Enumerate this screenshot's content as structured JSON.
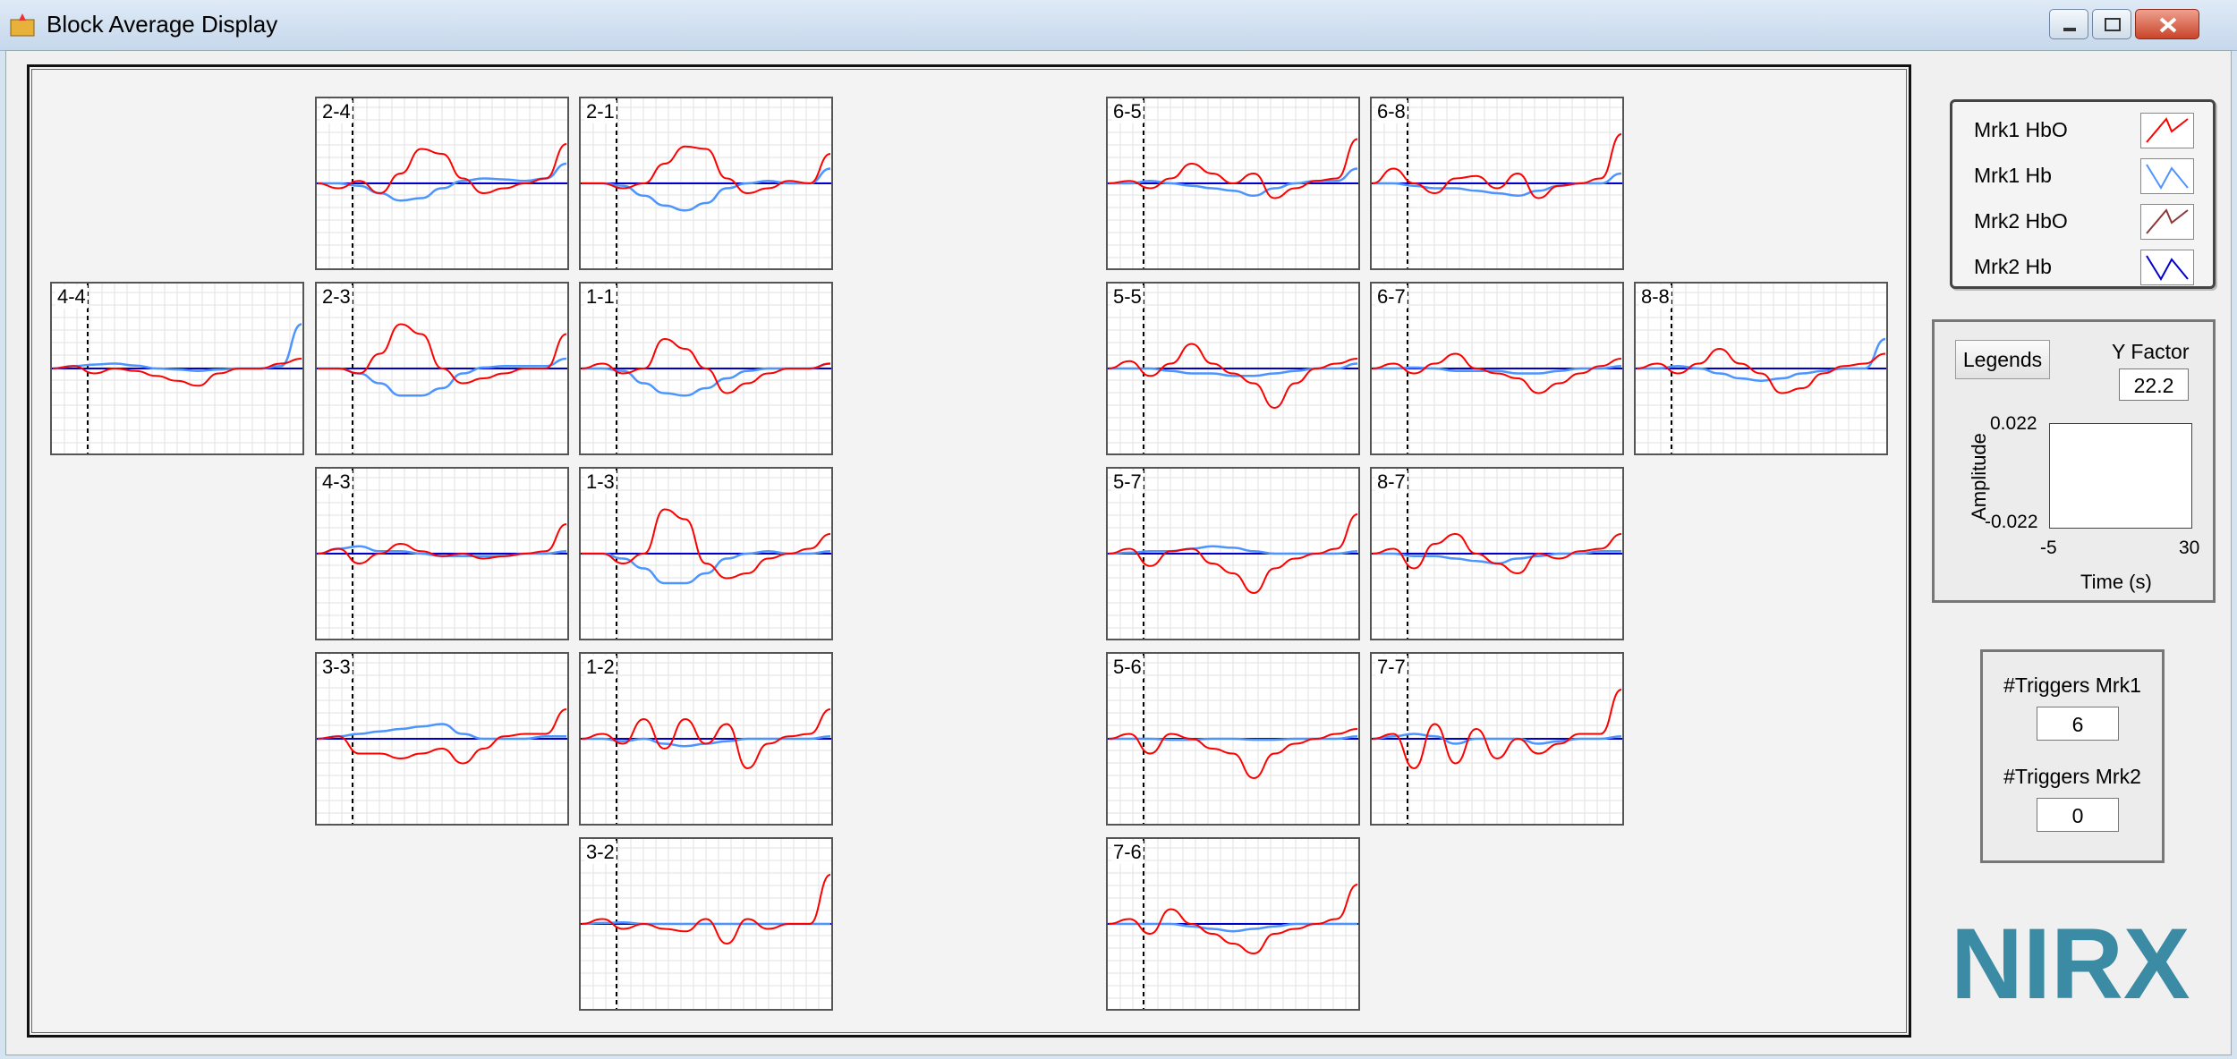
{
  "window": {
    "title": "Block Average Display",
    "icon": "nirx-app-icon"
  },
  "colors": {
    "mrk1_hbo": "#ff0000",
    "mrk1_hb": "#4d94ff",
    "mrk2_hbo": "#8b3a3a",
    "mrk2_hb": "#0000cc",
    "logo_teal": "#3b8ba4",
    "logo_orange": "#f0a020"
  },
  "plots": [
    {
      "label": "2-4",
      "hbo": [
        0,
        -0.1,
        0.05,
        -0.2,
        0.2,
        0.7,
        0.6,
        0.1,
        -0.2,
        -0.1,
        0,
        0.1,
        0.8
      ],
      "hb": [
        0,
        0,
        -0.05,
        -0.2,
        -0.35,
        -0.3,
        -0.1,
        0.05,
        0.1,
        0.08,
        0.05,
        0.1,
        0.4
      ]
    },
    {
      "label": "2-1",
      "hbo": [
        0,
        0,
        -0.1,
        0,
        0.4,
        0.75,
        0.7,
        0.1,
        -0.2,
        -0.1,
        0.05,
        0,
        0.6
      ],
      "hb": [
        0,
        0,
        -0.05,
        -0.25,
        -0.45,
        -0.55,
        -0.4,
        -0.1,
        0,
        0.05,
        0,
        0,
        0.3
      ]
    },
    {
      "label": "6-5",
      "hbo": [
        0,
        0.05,
        -0.1,
        0.1,
        0.4,
        0.2,
        0,
        0.2,
        -0.3,
        -0.1,
        0.05,
        0.1,
        0.9
      ],
      "hb": [
        0,
        0,
        0.05,
        0,
        -0.05,
        -0.1,
        -0.15,
        -0.25,
        -0.1,
        0,
        0.05,
        0.05,
        0.3
      ]
    },
    {
      "label": "6-8",
      "hbo": [
        0,
        0.3,
        0,
        -0.2,
        0.1,
        0.15,
        -0.1,
        0.2,
        -0.3,
        -0.05,
        0,
        0.1,
        1.0
      ],
      "hb": [
        0,
        0,
        -0.05,
        -0.1,
        -0.1,
        -0.15,
        -0.2,
        -0.25,
        -0.15,
        -0.05,
        0,
        0,
        0.2
      ]
    },
    {
      "label": "4-4",
      "hbo": [
        0,
        0.05,
        -0.1,
        0,
        -0.05,
        -0.15,
        -0.25,
        -0.35,
        -0.1,
        0,
        0,
        0.1,
        0.2
      ],
      "hb": [
        0,
        0.05,
        0.08,
        0.1,
        0.06,
        0,
        -0.02,
        -0.05,
        -0.02,
        0,
        0,
        0.05,
        0.9
      ]
    },
    {
      "label": "2-3",
      "hbo": [
        0,
        0,
        -0.1,
        0.3,
        0.9,
        0.7,
        0,
        -0.3,
        -0.2,
        -0.1,
        0,
        0,
        0.7
      ],
      "hb": [
        0,
        0,
        -0.1,
        -0.3,
        -0.55,
        -0.55,
        -0.4,
        -0.1,
        0.02,
        0.05,
        0.05,
        0.05,
        0.2
      ]
    },
    {
      "label": "1-1",
      "hbo": [
        0,
        0.1,
        -0.1,
        0,
        0.6,
        0.4,
        0,
        -0.5,
        -0.3,
        -0.1,
        0,
        0,
        0.1
      ],
      "hb": [
        0,
        0,
        -0.05,
        -0.3,
        -0.5,
        -0.55,
        -0.4,
        -0.2,
        -0.05,
        0,
        0,
        0,
        0.1
      ]
    },
    {
      "label": "5-5",
      "hbo": [
        0,
        0.15,
        -0.15,
        0.1,
        0.5,
        0.1,
        -0.1,
        -0.3,
        -0.8,
        -0.3,
        0,
        0.1,
        0.2
      ],
      "hb": [
        0,
        0,
        0,
        -0.05,
        -0.1,
        -0.1,
        -0.15,
        -0.15,
        -0.1,
        -0.05,
        0,
        0,
        0.1
      ]
    },
    {
      "label": "6-7",
      "hbo": [
        0,
        0.1,
        -0.1,
        0.1,
        0.3,
        0,
        -0.1,
        -0.2,
        -0.5,
        -0.3,
        -0.1,
        0.05,
        0.2
      ],
      "hb": [
        0,
        0,
        0.02,
        0,
        -0.05,
        -0.05,
        -0.05,
        -0.1,
        -0.1,
        -0.05,
        0,
        0,
        0.05
      ]
    },
    {
      "label": "8-8",
      "hbo": [
        0,
        0.1,
        -0.1,
        0.1,
        0.4,
        0.1,
        -0.1,
        -0.5,
        -0.4,
        -0.1,
        0.05,
        0.1,
        0.3
      ],
      "hb": [
        0,
        0,
        0.05,
        0,
        -0.1,
        -0.2,
        -0.25,
        -0.2,
        -0.1,
        -0.05,
        0,
        0,
        0.6
      ]
    },
    {
      "label": "4-3",
      "hbo": [
        0,
        0.1,
        -0.2,
        0,
        0.2,
        0.05,
        -0.05,
        0,
        -0.1,
        -0.05,
        0,
        0.05,
        0.6
      ],
      "hb": [
        0,
        0.1,
        0.15,
        0.05,
        0.05,
        0,
        -0.05,
        -0.05,
        -0.05,
        -0.05,
        0,
        0,
        0.05
      ]
    },
    {
      "label": "1-3",
      "hbo": [
        0,
        0,
        -0.2,
        0,
        0.9,
        0.7,
        -0.2,
        -0.5,
        -0.4,
        -0.1,
        0,
        0.1,
        0.4
      ],
      "hb": [
        0,
        0,
        -0.1,
        -0.3,
        -0.6,
        -0.6,
        -0.4,
        -0.1,
        0,
        0.05,
        0,
        0,
        0.05
      ]
    },
    {
      "label": "5-7",
      "hbo": [
        0,
        0.1,
        -0.25,
        0.05,
        0.1,
        -0.2,
        -0.4,
        -0.8,
        -0.3,
        -0.1,
        0,
        0.1,
        0.8
      ],
      "hb": [
        0,
        0.02,
        0.05,
        0.05,
        0.1,
        0.15,
        0.12,
        0.05,
        0,
        0,
        0,
        0,
        0.05
      ]
    },
    {
      "label": "8-7",
      "hbo": [
        0,
        0.1,
        -0.3,
        0.2,
        0.4,
        0,
        -0.2,
        -0.4,
        0,
        -0.1,
        0.05,
        0.1,
        0.4
      ],
      "hb": [
        0,
        0,
        -0.05,
        -0.05,
        -0.1,
        -0.15,
        -0.2,
        -0.1,
        -0.05,
        0,
        0,
        0.05,
        0.05
      ]
    },
    {
      "label": "3-3",
      "hbo": [
        0,
        0.05,
        -0.3,
        -0.3,
        -0.4,
        -0.3,
        -0.2,
        -0.5,
        -0.2,
        0.05,
        0.1,
        0.1,
        0.6
      ],
      "hb": [
        0,
        0.05,
        0.1,
        0.15,
        0.2,
        0.25,
        0.3,
        0.1,
        0,
        0,
        0,
        0.05,
        0.05
      ]
    },
    {
      "label": "1-2",
      "hbo": [
        0,
        0.1,
        -0.1,
        0.4,
        -0.2,
        0.4,
        -0.1,
        0.3,
        -0.6,
        -0.1,
        0.05,
        0.1,
        0.6
      ],
      "hb": [
        0,
        0,
        -0.05,
        0,
        -0.1,
        -0.15,
        -0.1,
        -0.05,
        0,
        0,
        0,
        0,
        0.05
      ]
    },
    {
      "label": "5-6",
      "hbo": [
        0,
        0.1,
        -0.3,
        0.1,
        0,
        -0.2,
        -0.3,
        -0.8,
        -0.3,
        -0.1,
        0,
        0.1,
        0.2
      ],
      "hb": [
        0,
        0,
        0,
        -0.02,
        -0.02,
        0,
        0,
        -0.02,
        -0.02,
        0,
        0,
        0,
        0.05
      ]
    },
    {
      "label": "7-7",
      "hbo": [
        0,
        0.1,
        -0.6,
        0.3,
        -0.5,
        0.2,
        -0.4,
        0,
        -0.3,
        -0.1,
        0.1,
        0.1,
        1.0
      ],
      "hb": [
        0,
        0.05,
        0.1,
        0.05,
        -0.1,
        0,
        0,
        0,
        -0.1,
        -0.05,
        0,
        0,
        0.05
      ]
    },
    {
      "label": "3-2",
      "hbo": [
        0,
        0.1,
        -0.1,
        0,
        -0.1,
        -0.15,
        0.1,
        -0.4,
        0.1,
        -0.1,
        0,
        0,
        1.0
      ],
      "hb": [
        0,
        0.02,
        0.03,
        0,
        0,
        0,
        0,
        0,
        0,
        0,
        0,
        0,
        0
      ]
    },
    {
      "label": "7-6",
      "hbo": [
        0,
        0.1,
        -0.2,
        0.3,
        0,
        -0.2,
        -0.4,
        -0.6,
        -0.2,
        -0.1,
        0,
        0.1,
        0.8
      ],
      "hb": [
        0,
        0,
        0,
        0,
        -0.05,
        -0.1,
        -0.15,
        -0.1,
        -0.05,
        0,
        0,
        0,
        0
      ]
    }
  ],
  "legend": {
    "items": [
      {
        "label": "Mrk1 HbO",
        "color_key": "mrk1_hbo"
      },
      {
        "label": "Mrk1 Hb",
        "color_key": "mrk1_hb"
      },
      {
        "label": "Mrk2 HbO",
        "color_key": "mrk2_hbo"
      },
      {
        "label": "Mrk2 Hb",
        "color_key": "mrk2_hb"
      }
    ]
  },
  "controls": {
    "legends_button": "Legends",
    "yfactor_label": "Y Factor",
    "yfactor_value": "22.2",
    "amp_max": "0.022",
    "amp_min": "-0.022",
    "amp_label": "Amplitude",
    "time_min": "-5",
    "time_max": "30",
    "time_label": "Time (s)"
  },
  "triggers": {
    "mrk1_label": "#Triggers Mrk1",
    "mrk1_value": "6",
    "mrk2_label": "#Triggers Mrk2",
    "mrk2_value": "0"
  },
  "logo": {
    "text": "NIRX"
  }
}
